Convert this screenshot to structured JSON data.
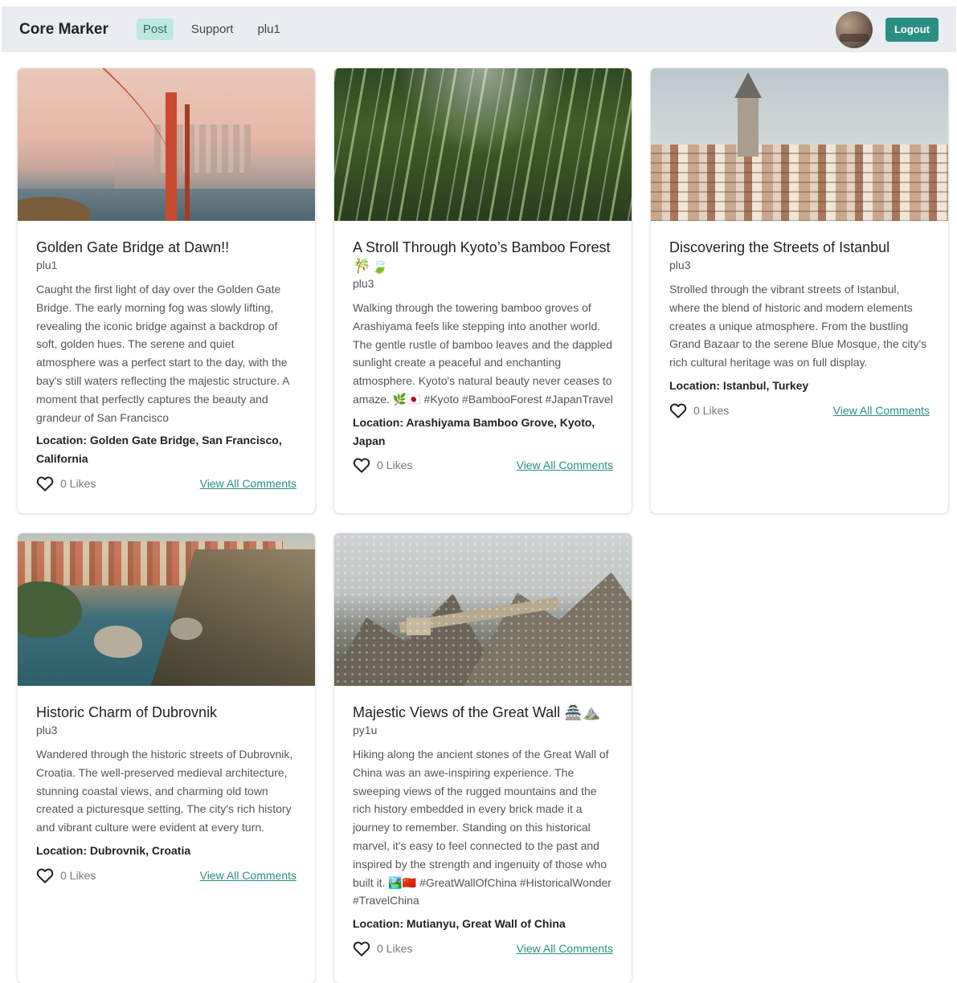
{
  "navbar": {
    "brand": "Core Marker",
    "links": [
      {
        "label": "Post",
        "active": true
      },
      {
        "label": "Support",
        "active": false
      },
      {
        "label": "plu1",
        "active": false
      }
    ],
    "logout_label": "Logout"
  },
  "colors": {
    "accent": "#2a8e84",
    "nav_background": "#e9edf1",
    "active_link_background": "#bde8de"
  },
  "posts": [
    {
      "title": "Golden Gate Bridge at Dawn!!",
      "author": "plu1",
      "text": "Caught the first light of day over the Golden Gate Bridge. The early morning fog was slowly lifting, revealing the iconic bridge against a backdrop of soft, golden hues. The serene and quiet atmosphere was a perfect start to the day, with the bay's still waters reflecting the majestic structure. A moment that perfectly captures the beauty and grandeur of San Francisco",
      "location": "Location: Golden Gate Bridge, San Francisco, California",
      "likes": "0 Likes",
      "comments_link": "View All Comments"
    },
    {
      "title": "A Stroll Through Kyoto’s Bamboo Forest 🎋🍃",
      "author": "plu3",
      "text": "Walking through the towering bamboo groves of Arashiyama feels like stepping into another world. The gentle rustle of bamboo leaves and the dappled sunlight create a peaceful and enchanting atmosphere. Kyoto's natural beauty never ceases to amaze. 🌿🇯🇵 #Kyoto #BambooForest #JapanTravel",
      "location": "Location: Arashiyama Bamboo Grove, Kyoto, Japan",
      "likes": "0 Likes",
      "comments_link": "View All Comments"
    },
    {
      "title": "Discovering the Streets of Istanbul",
      "author": "plu3",
      "text": "Strolled through the vibrant streets of Istanbul, where the blend of historic and modern elements creates a unique atmosphere. From the bustling Grand Bazaar to the serene Blue Mosque, the city's rich cultural heritage was on full display.",
      "location": "Location: Istanbul, Turkey",
      "likes": "0 Likes",
      "comments_link": "View All Comments"
    },
    {
      "title": "Historic Charm of Dubrovnik",
      "author": "plu3",
      "text": "Wandered through the historic streets of Dubrovnik, Croatia. The well-preserved medieval architecture, stunning coastal views, and charming old town created a picturesque setting. The city's rich history and vibrant culture were evident at every turn.",
      "location": "Location: Dubrovnik, Croatia",
      "likes": "0 Likes",
      "comments_link": "View All Comments"
    },
    {
      "title": "Majestic Views of the Great Wall 🏯⛰️",
      "author": "py1u",
      "text": "Hiking along the ancient stones of the Great Wall of China was an awe-inspiring experience. The sweeping views of the rugged mountains and the rich history embedded in every brick made it a journey to remember. Standing on this historical marvel, it's easy to feel connected to the past and inspired by the strength and ingenuity of those who built it. 🏞️🇨🇳 #GreatWallOfChina #HistoricalWonder #TravelChina",
      "location": "Location: Mutianyu, Great Wall of China",
      "likes": "0 Likes",
      "comments_link": "View All Comments"
    }
  ]
}
